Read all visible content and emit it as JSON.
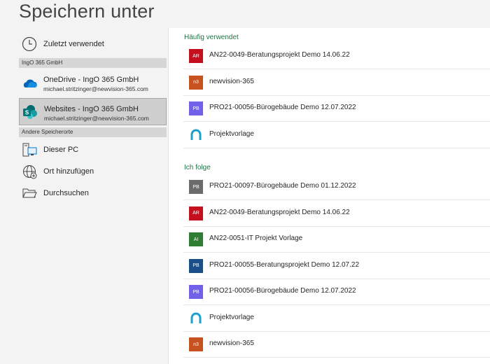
{
  "page_title": "Speichern unter",
  "left": {
    "recent": {
      "label": "Zuletzt verwendet",
      "icon": "clock-icon"
    },
    "section1": "IngO 365 GmbH",
    "onedrive": {
      "label": "OneDrive - IngO 365 GmbH",
      "email": "michael.stritzinger@newvision-365.com",
      "icon": "onedrive-cloud-icon"
    },
    "websites": {
      "label": "Websites - IngO 365 GmbH",
      "email": "michael.stritzinger@newvision-365.com",
      "icon": "sharepoint-icon",
      "selected": true
    },
    "section2": "Andere Speicherorte",
    "this_pc": {
      "label": "Dieser PC",
      "icon": "computer-icon"
    },
    "add_place": {
      "label": "Ort hinzufügen",
      "icon": "globe-add-icon"
    },
    "browse": {
      "label": "Durchsuchen",
      "icon": "folder-icon"
    }
  },
  "frequent": {
    "header": "Häufig verwendet",
    "items": [
      {
        "badge": "AR",
        "color": "#c50f1f",
        "name": "AN22-0049-Beratungsprojekt Demo 14.06.22"
      },
      {
        "badge": "n3",
        "color": "#c7511f",
        "name": "newvision-365"
      },
      {
        "badge": "PB",
        "color": "#7160e8",
        "name": "PRO21-00056-Bürogebäude Demo 12.07.2022"
      },
      {
        "badge": "",
        "color": "logo",
        "name": "Projektvorlage"
      }
    ]
  },
  "following": {
    "header": "Ich folge",
    "items": [
      {
        "badge": "PB",
        "color": "#6b6b6b",
        "name": "PRO21-00097-Bürogebäude Demo 01.12.2022"
      },
      {
        "badge": "AR",
        "color": "#c50f1f",
        "name": "AN22-0049-Beratungsprojekt Demo 14.06.22"
      },
      {
        "badge": "AI",
        "color": "#2e7d32",
        "name": "AN22-0051-IT Projekt Vorlage"
      },
      {
        "badge": "PB",
        "color": "#1b4f8c",
        "name": "PRO21-00055-Beratungsprojekt Demo 12.07.22"
      },
      {
        "badge": "PB",
        "color": "#7160e8",
        "name": "PRO21-00056-Bürogebäude Demo 12.07.2022"
      },
      {
        "badge": "",
        "color": "logo",
        "name": "Projektvorlage"
      },
      {
        "badge": "n3",
        "color": "#c7511f",
        "name": "newvision-365"
      }
    ]
  }
}
